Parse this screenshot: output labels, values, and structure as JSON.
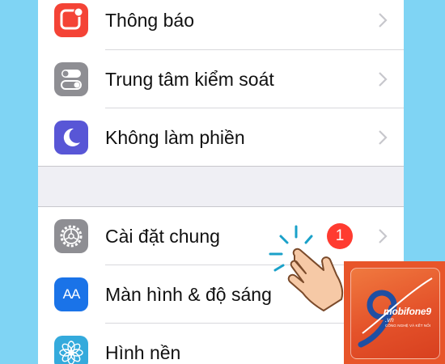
{
  "settings": {
    "group1": [
      {
        "label": "Thông báo",
        "icon": "notifications-icon",
        "color": "#f44336"
      },
      {
        "label": "Trung tâm kiểm soát",
        "icon": "control-center-icon",
        "color": "#8e8e93"
      },
      {
        "label": "Không làm phiền",
        "icon": "moon-icon",
        "color": "#5856d6"
      }
    ],
    "group2": [
      {
        "label": "Cài đặt chung",
        "icon": "gear-icon",
        "color": "#8e8e93",
        "badge": "1"
      },
      {
        "label": "Màn hình & độ sáng",
        "icon": "display-brightness-icon",
        "color": "#1a73e8",
        "icon_text": "AA"
      },
      {
        "label": "Hình nền",
        "icon": "wallpaper-flower-icon",
        "color": "#34aadc"
      }
    ]
  },
  "logo": {
    "brand": "mobifone9",
    "domain": ".vn",
    "tagline": "CÔNG NGHỆ VÀ KẾT NỐI",
    "color": "#e8552a"
  },
  "pointer": {
    "icon": "tap-hand-icon"
  }
}
